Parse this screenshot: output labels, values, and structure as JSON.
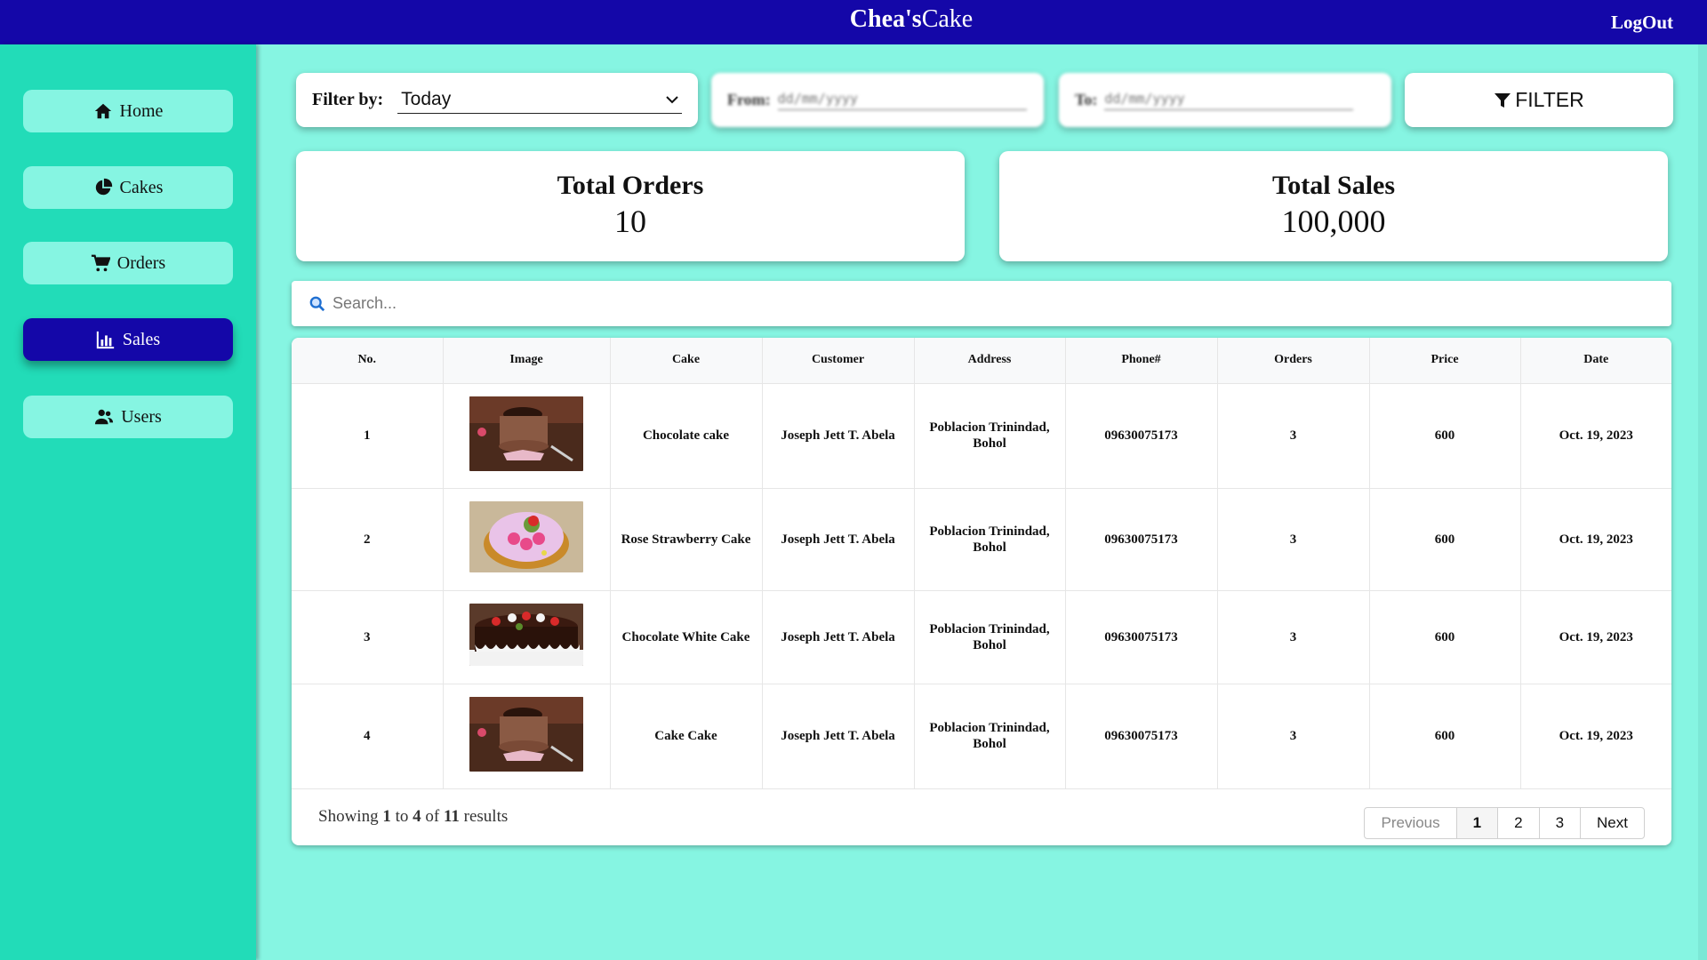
{
  "header": {
    "brand_bold": "Chea's",
    "brand_rest": "Cake",
    "logout": "LogOut"
  },
  "sidebar": {
    "items": [
      {
        "label": "Home",
        "icon": "home-icon"
      },
      {
        "label": "Cakes",
        "icon": "pie-chart-icon"
      },
      {
        "label": "Orders",
        "icon": "cart-icon"
      },
      {
        "label": "Sales",
        "icon": "bar-chart-icon",
        "active": true
      },
      {
        "label": "Users",
        "icon": "users-icon"
      }
    ]
  },
  "filter": {
    "label": "Filter by:",
    "selected": "Today",
    "from_label": "From:",
    "from_placeholder": "dd/mm/yyyy",
    "to_label": "To:",
    "to_placeholder": "dd/mm/yyyy",
    "button": "FILTER"
  },
  "stats": {
    "orders_title": "Total Orders",
    "orders_value": "10",
    "sales_title": "Total Sales",
    "sales_value": "100,000"
  },
  "search": {
    "placeholder": "Search..."
  },
  "table": {
    "headers": [
      "No.",
      "Image",
      "Cake",
      "Customer",
      "Address",
      "Phone#",
      "Orders",
      "Price",
      "Date"
    ],
    "rows": [
      {
        "no": "1",
        "image": "chocolate-cake-photo",
        "cake": "Chocolate cake",
        "customer": "Joseph Jett T. Abela",
        "address": "Poblacion Trinindad, Bohol",
        "phone": "09630075173",
        "orders": "3",
        "price": "600",
        "date": "Oct. 19, 2023"
      },
      {
        "no": "2",
        "image": "rose-strawberry-cake-photo",
        "cake": "Rose Strawberry Cake",
        "customer": "Joseph Jett T. Abela",
        "address": "Poblacion Trinindad, Bohol",
        "phone": "09630075173",
        "orders": "3",
        "price": "600",
        "date": "Oct. 19, 2023"
      },
      {
        "no": "3",
        "image": "chocolate-white-cake-photo",
        "cake": "Chocolate White Cake",
        "customer": "Joseph Jett T. Abela",
        "address": "Poblacion Trinindad, Bohol",
        "phone": "09630075173",
        "orders": "3",
        "price": "600",
        "date": "Oct. 19, 2023"
      },
      {
        "no": "4",
        "image": "chocolate-cake-photo",
        "cake": "Cake Cake",
        "customer": "Joseph Jett T. Abela",
        "address": "Poblacion Trinindad, Bohol",
        "phone": "09630075173",
        "orders": "3",
        "price": "600",
        "date": "Oct. 19, 2023"
      }
    ]
  },
  "pagination": {
    "showing_prefix": "Showing",
    "from": "1",
    "to_word": "to",
    "to": "4",
    "of_word": "of",
    "total": "11",
    "results_word": "results",
    "previous": "Previous",
    "pages": [
      "1",
      "2",
      "3"
    ],
    "current": "1",
    "next": "Next"
  },
  "colors": {
    "topbar": "#1407a8",
    "sidebar": "#22dcb8",
    "background": "#86f5e2",
    "active_nav": "#1407a8"
  }
}
